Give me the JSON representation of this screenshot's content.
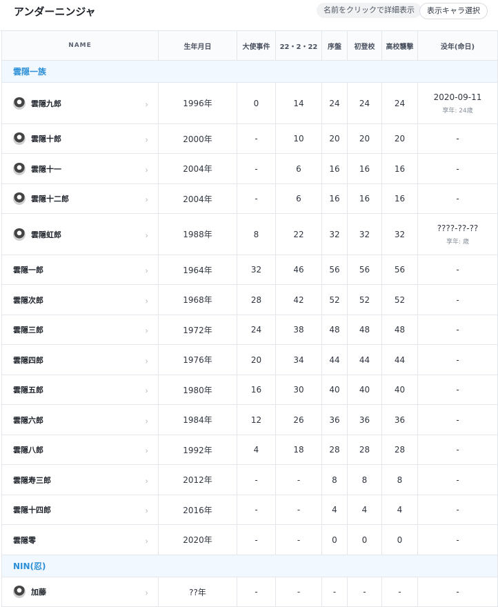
{
  "header": {
    "title": "アンダーニンジャ",
    "hint": "名前をクリックで詳細表示",
    "select_button": "表示キャラ選択"
  },
  "table": {
    "columns": [
      "NAME",
      "生年月日",
      "大使事件",
      "22・2・22",
      "序盤",
      "初登校",
      "高校襲撃",
      "没年(命日)"
    ],
    "groups": [
      {
        "label": "雲隠一族",
        "rows": [
          {
            "name": "雲隠九郎",
            "avatar": true,
            "birth": "1996年",
            "c1": "0",
            "c2": "14",
            "c3": "24",
            "c4": "24",
            "c5": "24",
            "death": "2020-09-11",
            "death_sub": "享年: 24歳"
          },
          {
            "name": "雲隠十郎",
            "avatar": true,
            "birth": "2000年",
            "c1": "-",
            "c2": "10",
            "c3": "20",
            "c4": "20",
            "c5": "20",
            "death": "-",
            "death_sub": ""
          },
          {
            "name": "雲隠十一",
            "avatar": true,
            "birth": "2004年",
            "c1": "-",
            "c2": "6",
            "c3": "16",
            "c4": "16",
            "c5": "16",
            "death": "-",
            "death_sub": ""
          },
          {
            "name": "雲隠十二郎",
            "avatar": true,
            "birth": "2004年",
            "c1": "-",
            "c2": "6",
            "c3": "16",
            "c4": "16",
            "c5": "16",
            "death": "-",
            "death_sub": ""
          },
          {
            "name": "雲隠虹郎",
            "avatar": true,
            "birth": "1988年",
            "c1": "8",
            "c2": "22",
            "c3": "32",
            "c4": "32",
            "c5": "32",
            "death": "????-??-??",
            "death_sub": "享年: 歳"
          },
          {
            "name": "雲隠一郎",
            "avatar": false,
            "birth": "1964年",
            "c1": "32",
            "c2": "46",
            "c3": "56",
            "c4": "56",
            "c5": "56",
            "death": "-",
            "death_sub": ""
          },
          {
            "name": "雲隠次郎",
            "avatar": false,
            "birth": "1968年",
            "c1": "28",
            "c2": "42",
            "c3": "52",
            "c4": "52",
            "c5": "52",
            "death": "-",
            "death_sub": ""
          },
          {
            "name": "雲隠三郎",
            "avatar": false,
            "birth": "1972年",
            "c1": "24",
            "c2": "38",
            "c3": "48",
            "c4": "48",
            "c5": "48",
            "death": "-",
            "death_sub": ""
          },
          {
            "name": "雲隠四郎",
            "avatar": false,
            "birth": "1976年",
            "c1": "20",
            "c2": "34",
            "c3": "44",
            "c4": "44",
            "c5": "44",
            "death": "-",
            "death_sub": ""
          },
          {
            "name": "雲隠五郎",
            "avatar": false,
            "birth": "1980年",
            "c1": "16",
            "c2": "30",
            "c3": "40",
            "c4": "40",
            "c5": "40",
            "death": "-",
            "death_sub": ""
          },
          {
            "name": "雲隠六郎",
            "avatar": false,
            "birth": "1984年",
            "c1": "12",
            "c2": "26",
            "c3": "36",
            "c4": "36",
            "c5": "36",
            "death": "-",
            "death_sub": ""
          },
          {
            "name": "雲隠八郎",
            "avatar": false,
            "birth": "1992年",
            "c1": "4",
            "c2": "18",
            "c3": "28",
            "c4": "28",
            "c5": "28",
            "death": "-",
            "death_sub": ""
          },
          {
            "name": "雲隠寿三郎",
            "avatar": false,
            "birth": "2012年",
            "c1": "-",
            "c2": "-",
            "c3": "8",
            "c4": "8",
            "c5": "8",
            "death": "-",
            "death_sub": ""
          },
          {
            "name": "雲隠十四郎",
            "avatar": false,
            "birth": "2016年",
            "c1": "-",
            "c2": "-",
            "c3": "4",
            "c4": "4",
            "c5": "4",
            "death": "-",
            "death_sub": ""
          },
          {
            "name": "雲隠零",
            "avatar": false,
            "birth": "2020年",
            "c1": "-",
            "c2": "-",
            "c3": "0",
            "c4": "0",
            "c5": "0",
            "death": "-",
            "death_sub": ""
          }
        ]
      },
      {
        "label": "NIN(忍)",
        "rows": [
          {
            "name": "加藤",
            "avatar": true,
            "birth": "??年",
            "c1": "-",
            "c2": "-",
            "c3": "-",
            "c4": "-",
            "c5": "-",
            "death": "-",
            "death_sub": ""
          }
        ]
      }
    ]
  },
  "icons": {
    "row_arrow": "chevron-right-icon",
    "avatar": "character-avatar-icon"
  },
  "colors": {
    "group_text": "#2b8fd8",
    "group_bg": "#f1f8ff"
  }
}
